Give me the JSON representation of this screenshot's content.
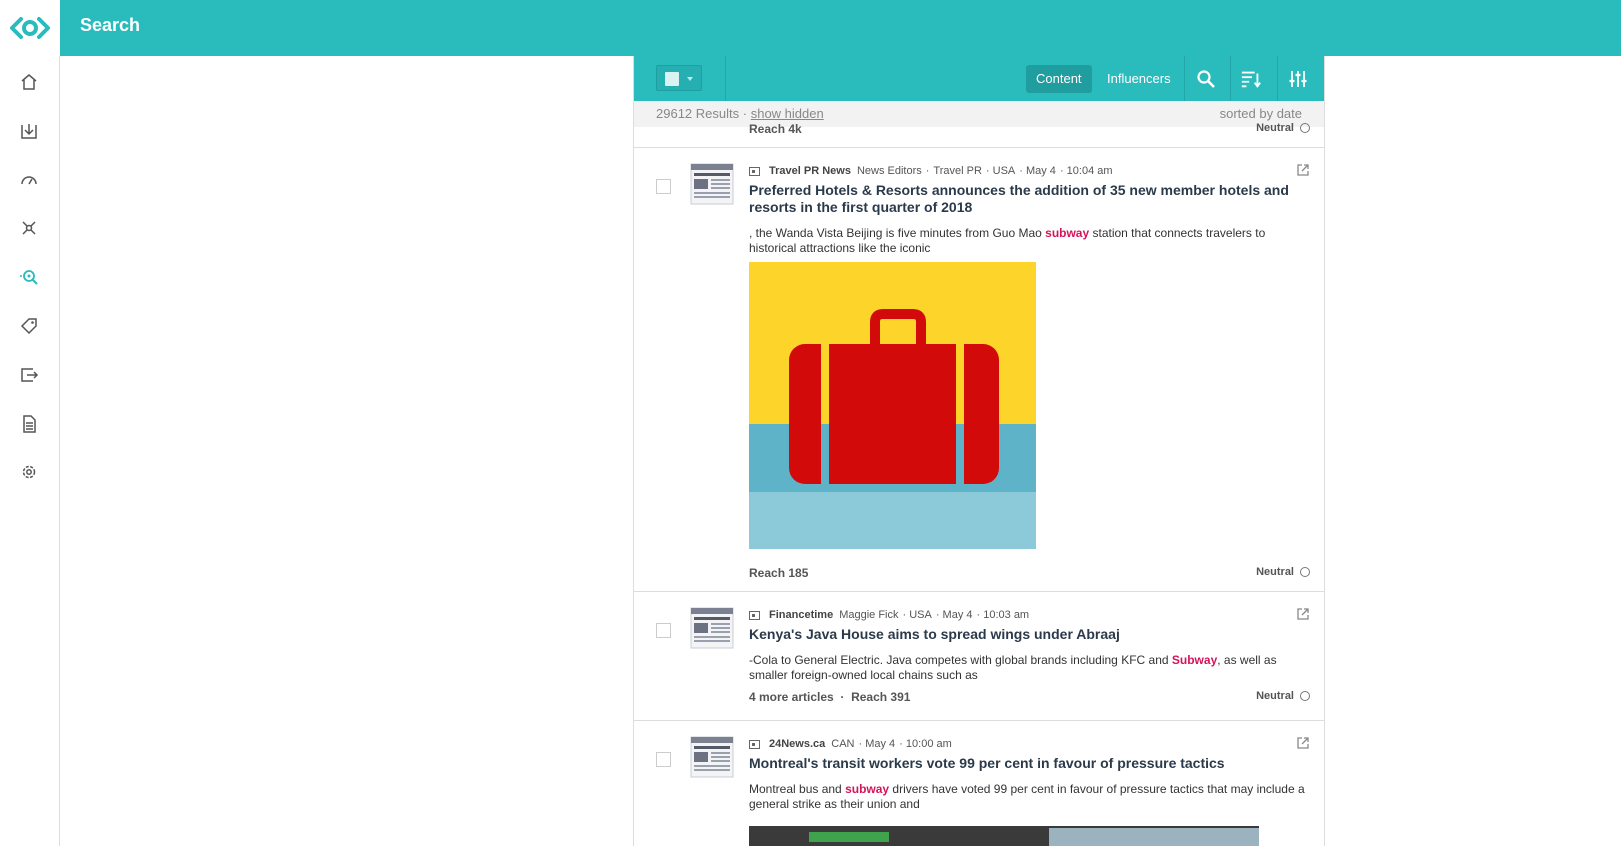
{
  "header": {
    "title": "Search"
  },
  "sidebar": {
    "items": [
      {
        "name": "home",
        "icon": "home-icon"
      },
      {
        "name": "import",
        "icon": "download-tray-icon"
      },
      {
        "name": "dashboard",
        "icon": "gauge-icon"
      },
      {
        "name": "network",
        "icon": "network-icon"
      },
      {
        "name": "search",
        "icon": "search-radar-icon",
        "active": true
      },
      {
        "name": "tags",
        "icon": "tag-icon"
      },
      {
        "name": "export",
        "icon": "export-icon"
      },
      {
        "name": "reports",
        "icon": "document-icon"
      },
      {
        "name": "settings",
        "icon": "gear-icon"
      }
    ]
  },
  "toolbar": {
    "tabs": [
      {
        "label": "Content",
        "active": true
      },
      {
        "label": "Influencers",
        "active": false
      }
    ]
  },
  "results_info": {
    "count": "29612 Results",
    "separator": "·",
    "show_hidden": "show hidden",
    "sort": "sorted by date"
  },
  "top_partial": {
    "reach": "Reach 4k",
    "sentiment": "Neutral"
  },
  "cards": [
    {
      "source": "Travel PR News",
      "meta": [
        "News Editors",
        "·",
        "Travel PR",
        "· USA",
        "· May 4",
        "· 10:04 am"
      ],
      "title": "Preferred Hotels & Resorts announces the addition of 35 new member hotels and resorts in the first quarter of 2018",
      "snippet_before": ", the Wanda Vista Beijing is five minutes from Guo Mao ",
      "snippet_highlight": "subway",
      "snippet_after": " station that connects travelers to historical attractions like the iconic",
      "reach": "Reach 185",
      "sentiment": "Neutral"
    },
    {
      "source": "Financetime",
      "meta": [
        "Maggie Fick",
        "· USA",
        "· May 4",
        "· 10:03 am"
      ],
      "title": "Kenya's Java House aims to spread wings under Abraaj",
      "snippet_before": "-Cola to General Electric. Java competes with global brands including KFC and ",
      "snippet_highlight": "Subway",
      "snippet_after": ", as well as smaller foreign-owned local chains such as",
      "more_articles": "4 more articles",
      "reach_sep": "·",
      "reach": "Reach 391",
      "sentiment": "Neutral"
    },
    {
      "source": "24News.ca",
      "meta": [
        "CAN",
        "· May 4",
        "· 10:00 am"
      ],
      "title": "Montreal's transit workers vote 99 per cent in favour of pressure tactics",
      "snippet_before": "Montreal bus and ",
      "snippet_highlight": "subway",
      "snippet_after": " drivers have voted 99 per cent in favour of pressure tactics that may include a general strike as their union and"
    }
  ],
  "colors": {
    "brand": "#2abbbd",
    "highlight": "#d4145a",
    "suitcase": "#d20a0a",
    "sky": "#fdd52a",
    "water": "#5fb3c8"
  }
}
